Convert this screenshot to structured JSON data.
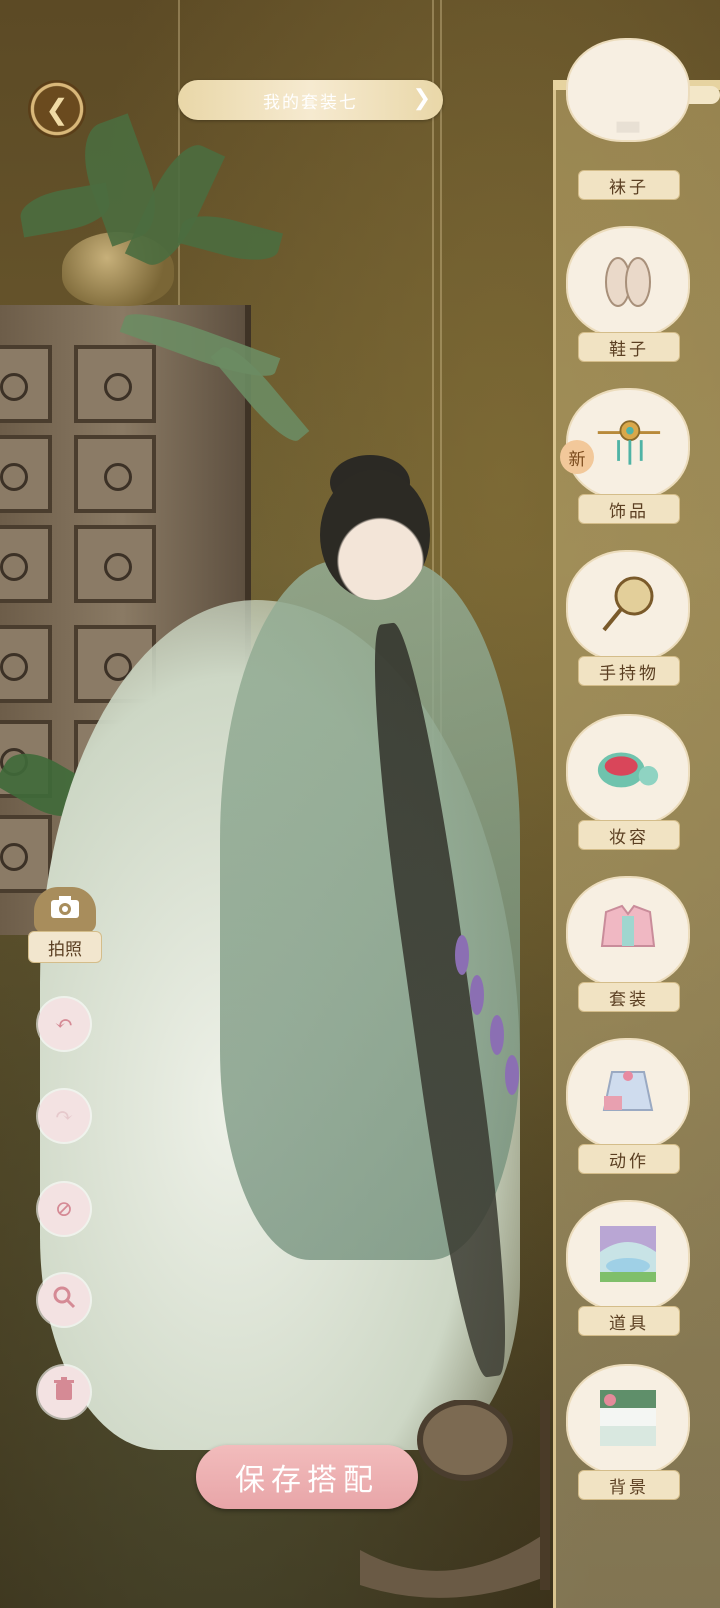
{
  "header": {
    "back_icon": "chevron-left-icon",
    "outfit_name": "我的套装七",
    "next_icon": "chevron-right-icon"
  },
  "categories": [
    {
      "label": "袜子",
      "icon": "socks-icon",
      "is_new": false
    },
    {
      "label": "鞋子",
      "icon": "shoes-icon",
      "is_new": false
    },
    {
      "label": "饰品",
      "icon": "hairpin-icon",
      "is_new": true,
      "new_text": "新"
    },
    {
      "label": "手持物",
      "icon": "fan-icon",
      "is_new": false
    },
    {
      "label": "妆容",
      "icon": "makeup-icon",
      "is_new": false
    },
    {
      "label": "套装",
      "icon": "outfit-icon",
      "is_new": false
    },
    {
      "label": "动作",
      "icon": "pose-icon",
      "is_new": false
    },
    {
      "label": "道具",
      "icon": "prop-icon",
      "is_new": false
    },
    {
      "label": "背景",
      "icon": "background-icon",
      "is_new": false
    }
  ],
  "tools": {
    "photo_label": "拍照",
    "photo_icon": "camera-icon",
    "undo_icon": "undo-icon",
    "redo_icon": "redo-icon",
    "hide_icon": "prohibit-icon",
    "zoom_icon": "magnifier-icon",
    "delete_icon": "trash-icon"
  },
  "save_button": "保存搭配",
  "colors": {
    "accent_pink": "#e8a5a8",
    "panel_gold": "#d9c48f",
    "label_brown": "#5b3f22"
  }
}
